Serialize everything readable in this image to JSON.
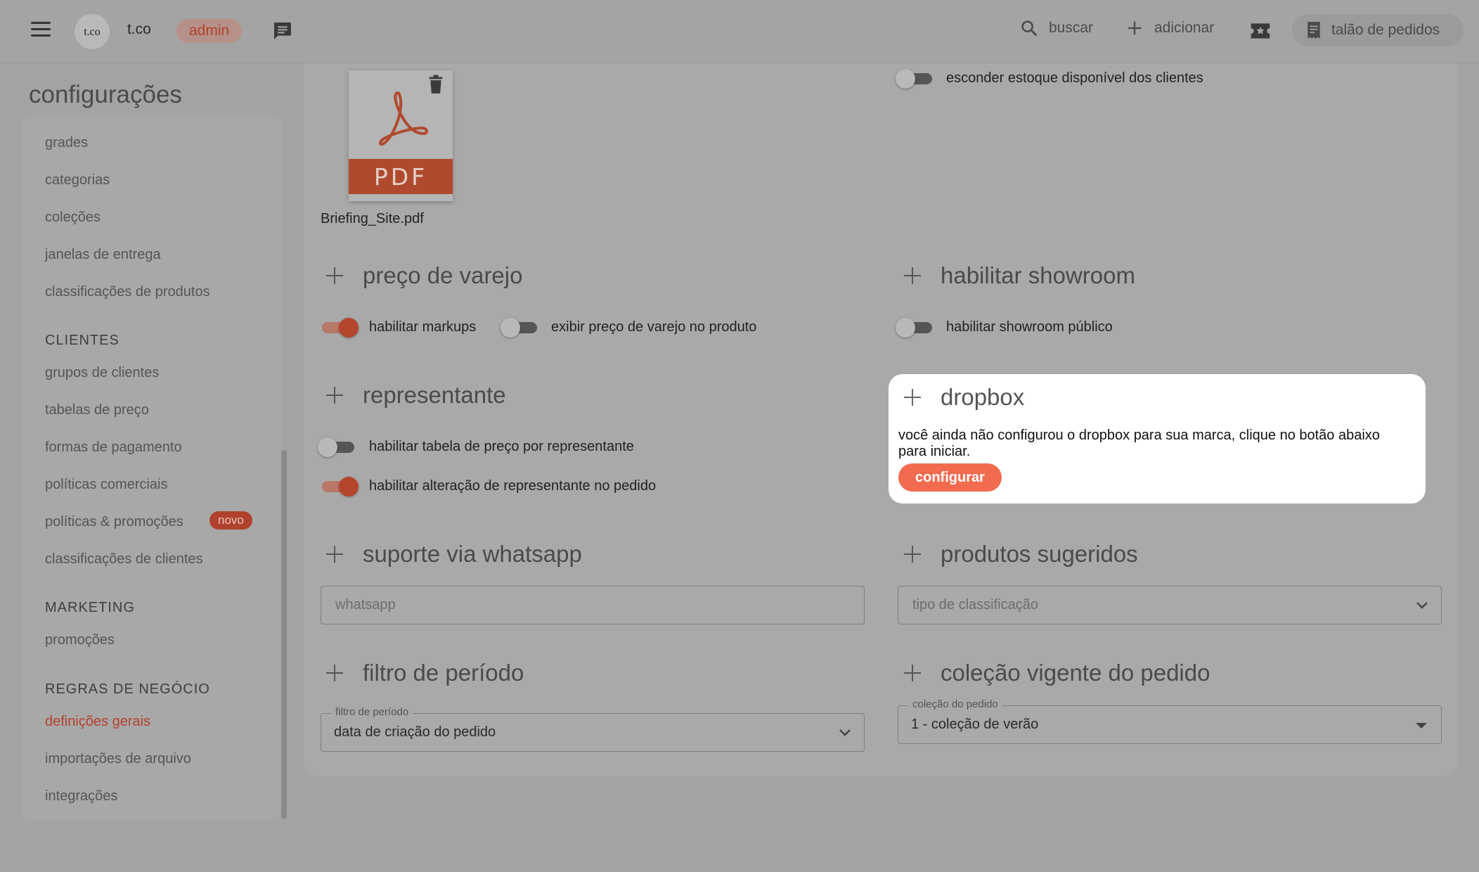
{
  "topbar": {
    "brand_logo_text": "t.co",
    "brand_name": "t.co",
    "role_badge": "admin",
    "search_label": "buscar",
    "add_label": "adicionar",
    "orders_label": "talão de pedidos"
  },
  "sidebar": {
    "title": "configurações",
    "items": [
      {
        "label": "grades"
      },
      {
        "label": "categorias"
      },
      {
        "label": "coleções"
      },
      {
        "label": "janelas de entrega"
      },
      {
        "label": "classificações de produtos"
      }
    ],
    "sections": [
      {
        "title": "CLIENTES",
        "items": [
          {
            "label": "grupos de clientes"
          },
          {
            "label": "tabelas de preço"
          },
          {
            "label": "formas de pagamento"
          },
          {
            "label": "políticas comerciais"
          },
          {
            "label": "políticas & promoções",
            "badge": "novo"
          },
          {
            "label": "classificações de clientes"
          }
        ]
      },
      {
        "title": "MARKETING",
        "items": [
          {
            "label": "promoções"
          }
        ]
      },
      {
        "title": "REGRAS DE NEGÓCIO",
        "items": [
          {
            "label": "definições gerais",
            "active": true
          },
          {
            "label": "importações de arquivo"
          },
          {
            "label": "integrações"
          }
        ]
      }
    ]
  },
  "main": {
    "file": {
      "type_label": "PDF",
      "name": "Briefing_Site.pdf"
    },
    "stock_toggle": {
      "label": "esconder estoque disponível dos clientes",
      "on": false
    },
    "retail_price": {
      "title": "preço de varejo",
      "toggles": [
        {
          "label": "habilitar markups",
          "on": true
        },
        {
          "label": "exibir preço de varejo no produto",
          "on": false
        }
      ]
    },
    "showroom": {
      "title": "habilitar showroom",
      "toggles": [
        {
          "label": "habilitar showroom público",
          "on": false
        }
      ]
    },
    "representative": {
      "title": "representante",
      "toggles": [
        {
          "label": "habilitar tabela de preço por representante",
          "on": false
        },
        {
          "label": "habilitar alteração de representante no pedido",
          "on": true
        }
      ]
    },
    "dropbox": {
      "title": "dropbox",
      "message": "você ainda não configurou o dropbox para sua marca, clique no botão abaixo para iniciar.",
      "button": "configurar"
    },
    "whatsapp": {
      "title": "suporte via whatsapp",
      "placeholder": "whatsapp"
    },
    "suggested": {
      "title": "produtos sugeridos",
      "placeholder": "tipo de classificação"
    },
    "period_filter": {
      "title": "filtro de período",
      "legend": "filtro de período",
      "value": "data de criação do pedido"
    },
    "current_collection": {
      "title": "coleção vigente do pedido",
      "legend": "coleção do pedido",
      "value": "1 - coleção de verão"
    }
  },
  "colors": {
    "accent": "#f26b4f",
    "active_nav": "#b4412e",
    "overlay_background": "#a3a3a3"
  }
}
